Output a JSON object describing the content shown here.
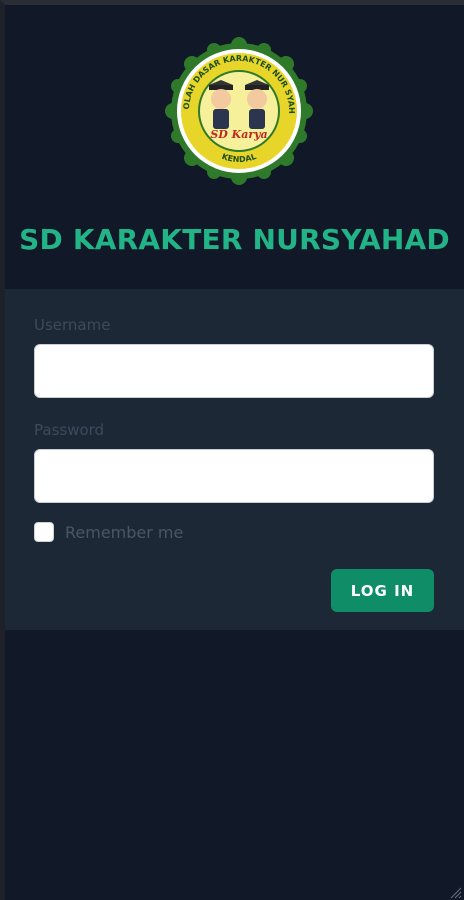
{
  "logo": {
    "ring_text_top": "SEKOLAH DASAR KARAKTER NUR SYAHAD",
    "ring_text_bottom": "KENDAL",
    "center_text": "SD Karya"
  },
  "school_name": "SD KARAKTER NURSYAHAD",
  "form": {
    "username_label": "Username",
    "username_value": "",
    "password_label": "Password",
    "password_value": "",
    "remember_label": "Remember me",
    "remember_checked": false,
    "submit_label": "LOG IN"
  },
  "colors": {
    "accent": "#22b386",
    "button": "#0e8d67",
    "card": "#1d2837",
    "background": "#111827"
  },
  "icons": {
    "resize": "resize-grip-icon"
  }
}
